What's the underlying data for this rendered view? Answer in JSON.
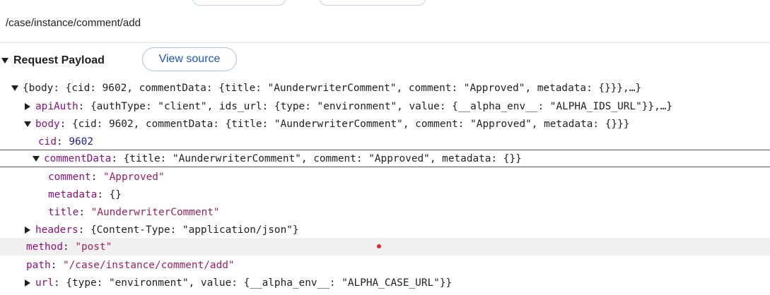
{
  "request": {
    "url_path": "/case/instance/comment/add"
  },
  "payload": {
    "section_title": "Request Payload",
    "view_source_label": "View source",
    "root_summary": "{body: {cid: 9602, commentData: {title: \"AunderwriterComment\", comment: \"Approved\", metadata: {}}},…}",
    "rows": [
      {
        "key": "apiAuth",
        "value": "{authType: \"client\", ids_url: {type: \"environment\", value: {__alpha_env__: \"ALPHA_IDS_URL\"}},…}"
      },
      {
        "key": "body",
        "value": "{cid: 9602, commentData: {title: \"AunderwriterComment\", comment: \"Approved\", metadata: {}}}"
      },
      {
        "key": "cid",
        "value": "9602"
      },
      {
        "key": "commentData",
        "value": "{title: \"AunderwriterComment\", comment: \"Approved\", metadata: {}}"
      },
      {
        "key": "comment",
        "value": "\"Approved\""
      },
      {
        "key": "metadata",
        "value": "{}"
      },
      {
        "key": "title",
        "value": "\"AunderwriterComment\""
      },
      {
        "key": "headers",
        "value": "{Content-Type: \"application/json\"}"
      },
      {
        "key": "method",
        "value": "\"post\""
      },
      {
        "key": "path",
        "value": "\"/case/instance/comment/add\""
      },
      {
        "key": "url",
        "value": "{type: \"environment\", value: {__alpha_env__: \"ALPHA_CASE_URL\"}}"
      }
    ]
  },
  "colors": {
    "key": "#881280",
    "string": "#9e1f5c",
    "number": "#1a1aa6",
    "link": "#1a55c4"
  },
  "icons": {
    "expanded": "triangle-down-icon",
    "collapsed": "triangle-right-icon"
  }
}
